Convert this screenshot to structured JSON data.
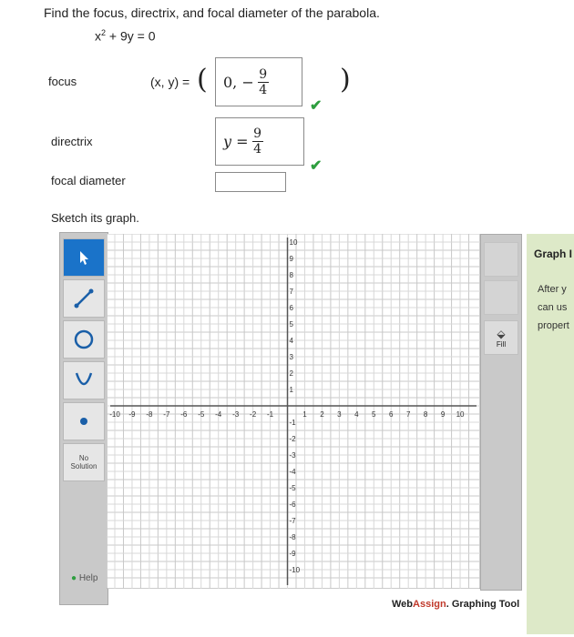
{
  "question": {
    "prompt": "Find the focus, directrix, and focal diameter of the parabola.",
    "equation_x": "x",
    "equation_exp": "2",
    "equation_rest": " + 9y = 0"
  },
  "focus": {
    "label": "focus",
    "prefix": "(x, y) = ",
    "open_paren": "(",
    "value_lead": "0, −",
    "num": "9",
    "den": "4",
    "close_paren": ")",
    "status": "correct"
  },
  "directrix": {
    "label": "directrix",
    "value_lead": "y =",
    "num": "9",
    "den": "4",
    "status": "correct"
  },
  "focal_diameter": {
    "label": "focal diameter",
    "value": ""
  },
  "sketch_label": "Sketch its graph.",
  "toolbar": {
    "tools": [
      "pointer-icon",
      "line-icon",
      "circle-icon",
      "parabola-icon",
      "point-icon"
    ],
    "no_solution": [
      "No",
      "Solution"
    ],
    "help": "Help"
  },
  "right_toolbar": {
    "fill": "Fill"
  },
  "graph": {
    "x_ticks": [
      -10,
      -9,
      -8,
      -7,
      -6,
      -5,
      -4,
      -3,
      -2,
      -1,
      1,
      2,
      3,
      4,
      5,
      6,
      7,
      8,
      9,
      10
    ],
    "y_ticks": [
      10,
      9,
      8,
      7,
      6,
      5,
      4,
      3,
      2,
      1,
      -1,
      -2,
      -3,
      -4,
      -5,
      -6,
      -7,
      -8,
      -9,
      -10
    ],
    "xlim": [
      -10,
      10
    ],
    "ylim": [
      -10,
      10
    ],
    "grid": true
  },
  "graph_info": {
    "title": "Graph I",
    "lines": [
      "After y",
      "can us",
      "propert"
    ]
  },
  "footer": {
    "brand_a": "Web",
    "brand_b": "Assign",
    "brand_rest": ". Graphing Tool"
  },
  "colors": {
    "check": "#2e9e3f",
    "selected_tool": "#1a73c9",
    "brand": "#c0392b"
  }
}
